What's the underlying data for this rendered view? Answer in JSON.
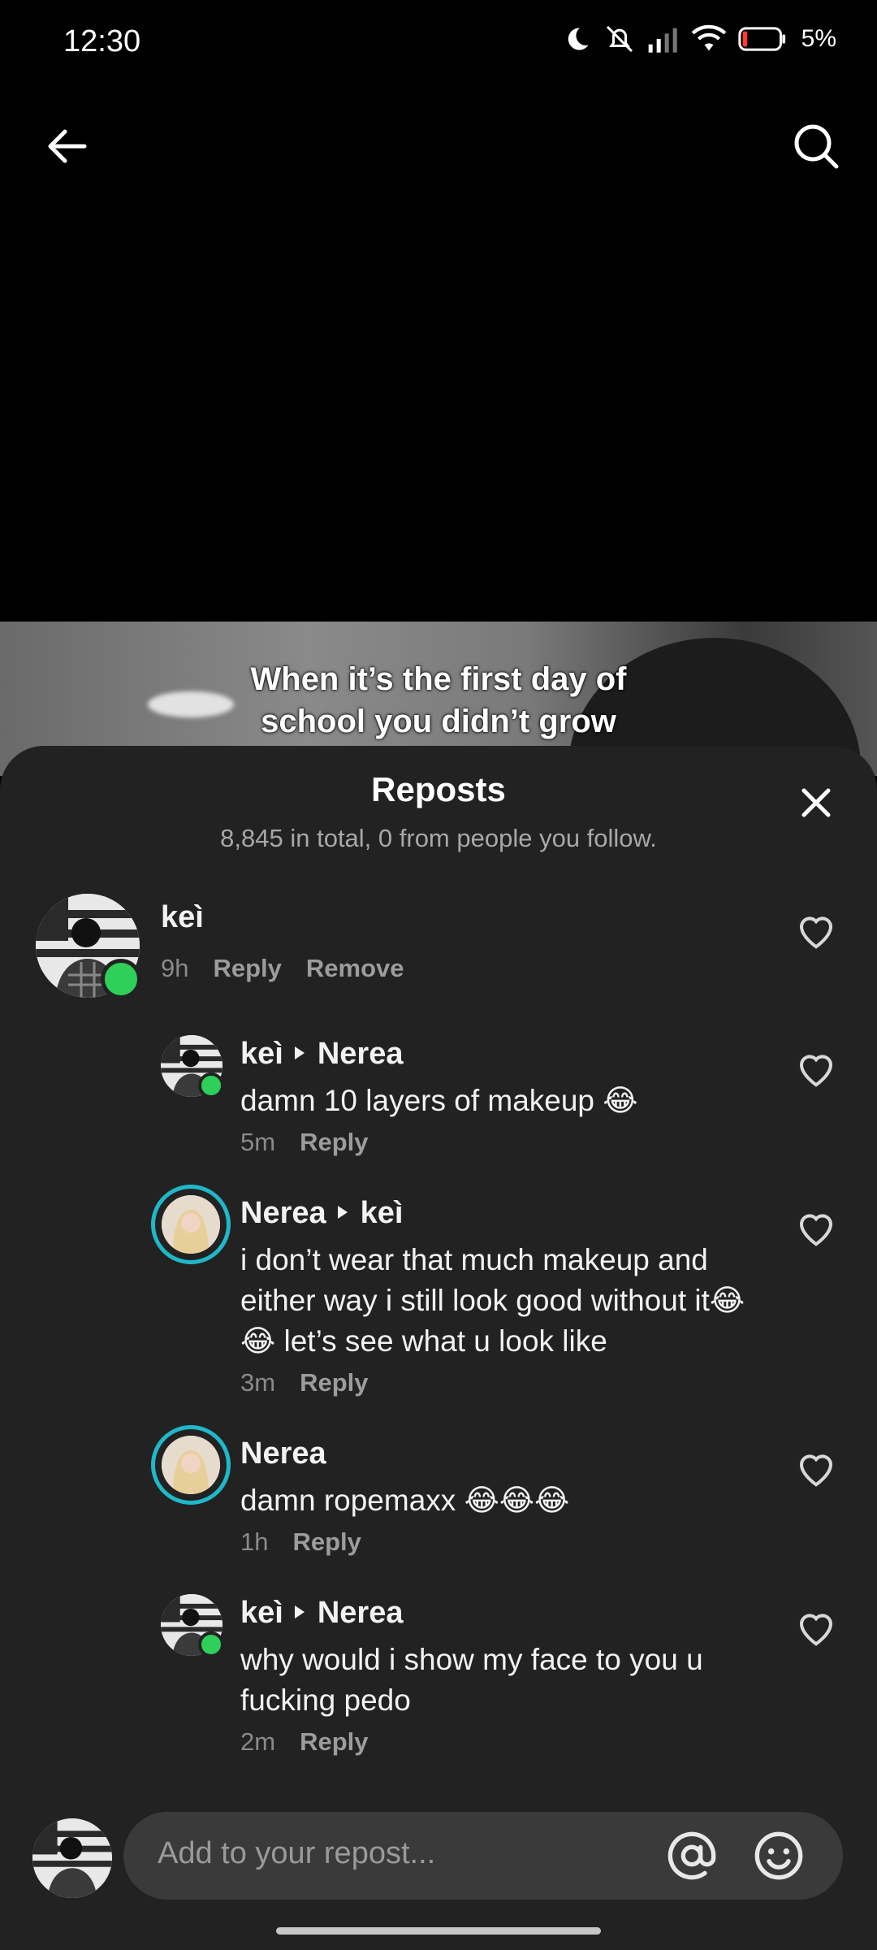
{
  "status_bar": {
    "time": "12:30",
    "battery": "5%"
  },
  "video": {
    "caption_line1": "When it’s the first day of",
    "caption_line2": "school you didn’t grow"
  },
  "sheet": {
    "title": "Reposts",
    "subtitle": "8,845 in total, 0 from people you follow."
  },
  "repost": {
    "name": "keì",
    "time": "9h",
    "reply_label": "Reply",
    "remove_label": "Remove"
  },
  "comments": [
    {
      "from": "keì",
      "to": "Nerea",
      "text": "damn 10 layers of makeup 😂",
      "time": "5m",
      "reply_label": "Reply"
    },
    {
      "from": "Nerea",
      "to": "keì",
      "text": "i don’t wear that much makeup and either way i still look good without it😂😂 let’s see what u look like",
      "time": "3m",
      "reply_label": "Reply"
    },
    {
      "from": "Nerea",
      "to": "",
      "text": "damn ropemaxx 😂😂😂",
      "time": "1h",
      "reply_label": "Reply"
    },
    {
      "from": "keì",
      "to": "Nerea",
      "text": "why would i show my face to you u fucking pedo",
      "time": "2m",
      "reply_label": "Reply"
    }
  ],
  "input": {
    "placeholder": "Add to your repost..."
  },
  "colors": {
    "sheet_bg": "#222223",
    "online": "#2ed05a",
    "story_ring": "#1fc2c2"
  },
  "icons": [
    "back-arrow-icon",
    "search-icon",
    "close-icon",
    "heart-icon",
    "at-icon",
    "emoji-icon"
  ]
}
